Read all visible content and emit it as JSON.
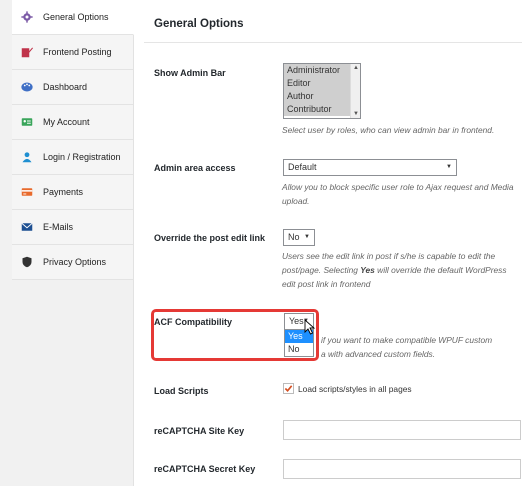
{
  "sidebar": {
    "items": [
      {
        "label": "General Options",
        "icon": "gear-icon",
        "active": true
      },
      {
        "label": "Frontend Posting",
        "icon": "edit-post-icon"
      },
      {
        "label": "Dashboard",
        "icon": "palette-icon"
      },
      {
        "label": "My Account",
        "icon": "account-card-icon"
      },
      {
        "label": "Login / Registration",
        "icon": "user-icon"
      },
      {
        "label": "Payments",
        "icon": "payments-icon"
      },
      {
        "label": "E-Mails",
        "icon": "mail-icon"
      },
      {
        "label": "Privacy Options",
        "icon": "shield-icon"
      }
    ]
  },
  "main": {
    "title": "General Options",
    "show_admin_bar": {
      "label": "Show Admin Bar",
      "options": [
        "Administrator",
        "Editor",
        "Author",
        "Contributor"
      ],
      "desc": "Select user by roles, who can view admin bar in frontend."
    },
    "admin_access": {
      "label": "Admin area access",
      "value": "Default",
      "desc": "Allow you to block specific user role to Ajax request and Media upload."
    },
    "override_edit": {
      "label": "Override the post edit link",
      "value": "No",
      "desc_part1": "Users see the edit link in post if s/he is capable to edit the post/page. Selecting ",
      "desc_bold": "Yes",
      "desc_part2": " will override the default WordPress edit post link in frontend"
    },
    "acf": {
      "label": "ACF Compatibility",
      "value": "Yes",
      "options": [
        "Yes",
        "No"
      ],
      "desc_line1": "if you want to make compatible WPUF custom",
      "desc_line2": "a with advanced custom fields."
    },
    "load_scripts": {
      "label": "Load Scripts",
      "checkbox_label": "Load scripts/styles in all pages",
      "checked": true
    },
    "recaptcha_site": {
      "label": "reCAPTCHA Site Key",
      "value": ""
    },
    "recaptcha_secret": {
      "label": "reCAPTCHA Secret Key",
      "value": ""
    }
  },
  "colors": {
    "highlight": "#e53935",
    "selected_option": "#1e90ff",
    "checkbox_check": "#d54e21"
  }
}
